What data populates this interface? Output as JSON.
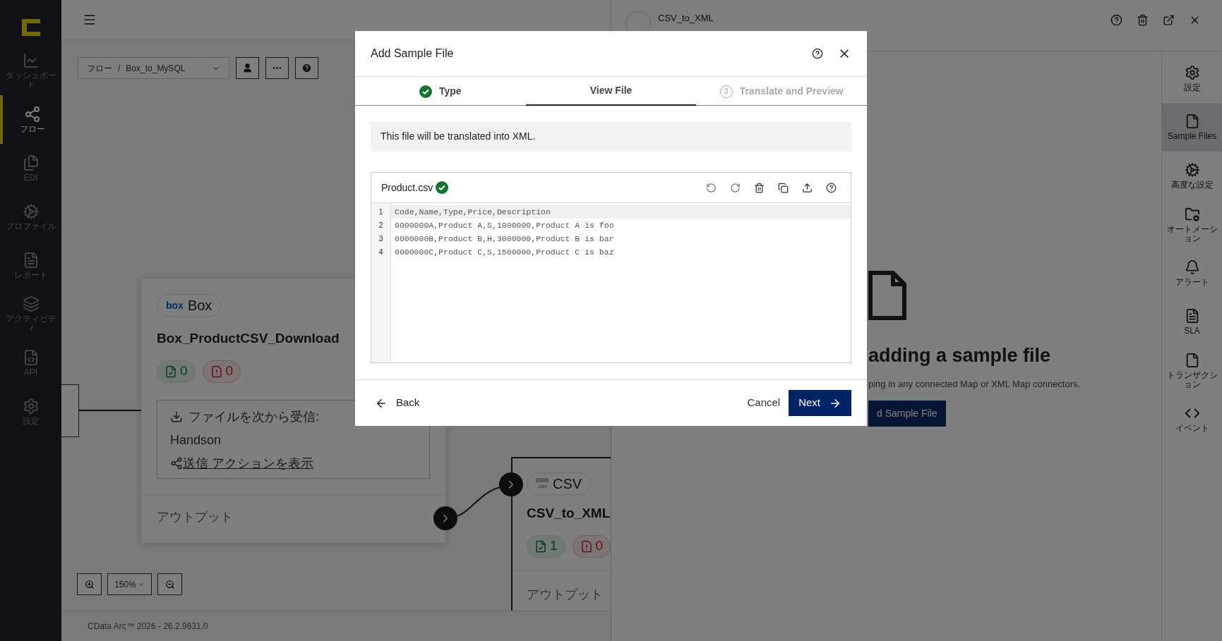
{
  "sidebar": {
    "items": [
      {
        "label": "ダッシュボード",
        "selected": false
      },
      {
        "label": "フロー",
        "selected": true
      },
      {
        "label": "EDI",
        "selected": false
      },
      {
        "label": "プロファイル",
        "selected": false
      },
      {
        "label": "レポート",
        "selected": false
      },
      {
        "label": "アクティビティ",
        "selected": false
      },
      {
        "label": "API",
        "selected": false
      },
      {
        "label": "設定",
        "selected": false
      }
    ]
  },
  "flow": {
    "breadcrumb": [
      "フロー",
      "/",
      "Box_to_MySQL"
    ],
    "zoom": "150%",
    "footer": "CData Arc™ 2026 - 26.2.9631.0",
    "nodes": [
      {
        "kind": "box",
        "badge_logo": "box",
        "badge": "Box",
        "name": "Box_ProductCSV_Download",
        "counts": [
          {
            "kind": "success",
            "value": "0"
          },
          {
            "kind": "error",
            "value": "0"
          }
        ],
        "receive_label": "ファイルを次から受信:",
        "receive_value": "Handson",
        "link": "送信 アクションを表示",
        "output": "アウトプット"
      },
      {
        "kind": "csv",
        "badge_logo": ".csv",
        "badge": "CSV",
        "name": "CSV_to_XML",
        "counts": [
          {
            "kind": "success",
            "value": "1"
          },
          {
            "kind": "error",
            "value": "0"
          }
        ],
        "output": "アウトプット"
      }
    ]
  },
  "panel": {
    "title": "CSV_to_XML",
    "heading": "adding a sample file",
    "text": "ping in any connected Map or XML Map connectors.",
    "button": "d Sample File"
  },
  "panel_sidebar": {
    "items": [
      {
        "label": "設定",
        "selected": false
      },
      {
        "label": "Sample Files",
        "selected": true
      },
      {
        "label": "高度な設定",
        "selected": false
      },
      {
        "label": "オートメーション",
        "selected": false
      },
      {
        "label": "アラート",
        "selected": false
      },
      {
        "label": "SLA",
        "selected": false
      },
      {
        "label": "トランザクション",
        "selected": false
      },
      {
        "label": "イベント",
        "selected": false
      }
    ]
  },
  "dialog": {
    "title": "Add Sample File",
    "tabs": [
      {
        "label": "Type",
        "selected": false,
        "complete": true,
        "disabled": false
      },
      {
        "label": "View File",
        "selected": true,
        "complete": false,
        "disabled": false
      },
      {
        "label": "Translate and Preview",
        "step": "3",
        "selected": false,
        "complete": false,
        "disabled": true
      }
    ],
    "info": "This file will be translated into XML.",
    "file": {
      "name": "Product.csv",
      "valid": true,
      "lines": [
        {
          "number": "1",
          "text": "Code,Name,Type,Price,Description",
          "selected": true
        },
        {
          "number": "2",
          "text": "0000000A,Product A,S,1000000,Product A is foo",
          "selected": false
        },
        {
          "number": "3",
          "text": "0000000B,Product B,H,3000000,Product B is bar",
          "selected": false
        },
        {
          "number": "4",
          "text": "0000000C,Product C,S,1500000,Product C is baz",
          "selected": false
        }
      ]
    },
    "back": "Back",
    "cancel": "Cancel",
    "next": "Next"
  }
}
